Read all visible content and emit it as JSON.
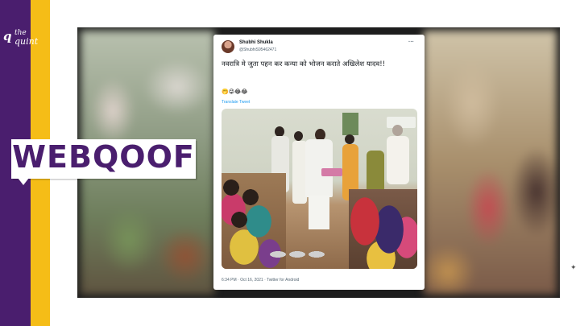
{
  "brand": {
    "logo_q": "q",
    "logo_the": "the",
    "logo_quint": "quint",
    "badge": "WEBQOOF"
  },
  "tweet": {
    "display_name": "Shubhi Shukla",
    "handle": "@ShubhiS95462471",
    "more": "···",
    "text": "नवरात्रि मे जुता पहन कर कन्या को भोजन कराते अखिलेश यादव!!",
    "emojis": "🤭😜😂😂",
    "translate": "Translate Tweet",
    "footer": "6:34 PM · Oct 16, 2021 · Twitter for Android"
  },
  "colors": {
    "purple": "#4a1e6e",
    "yellow": "#f5bd17",
    "link": "#1d9bf0"
  }
}
